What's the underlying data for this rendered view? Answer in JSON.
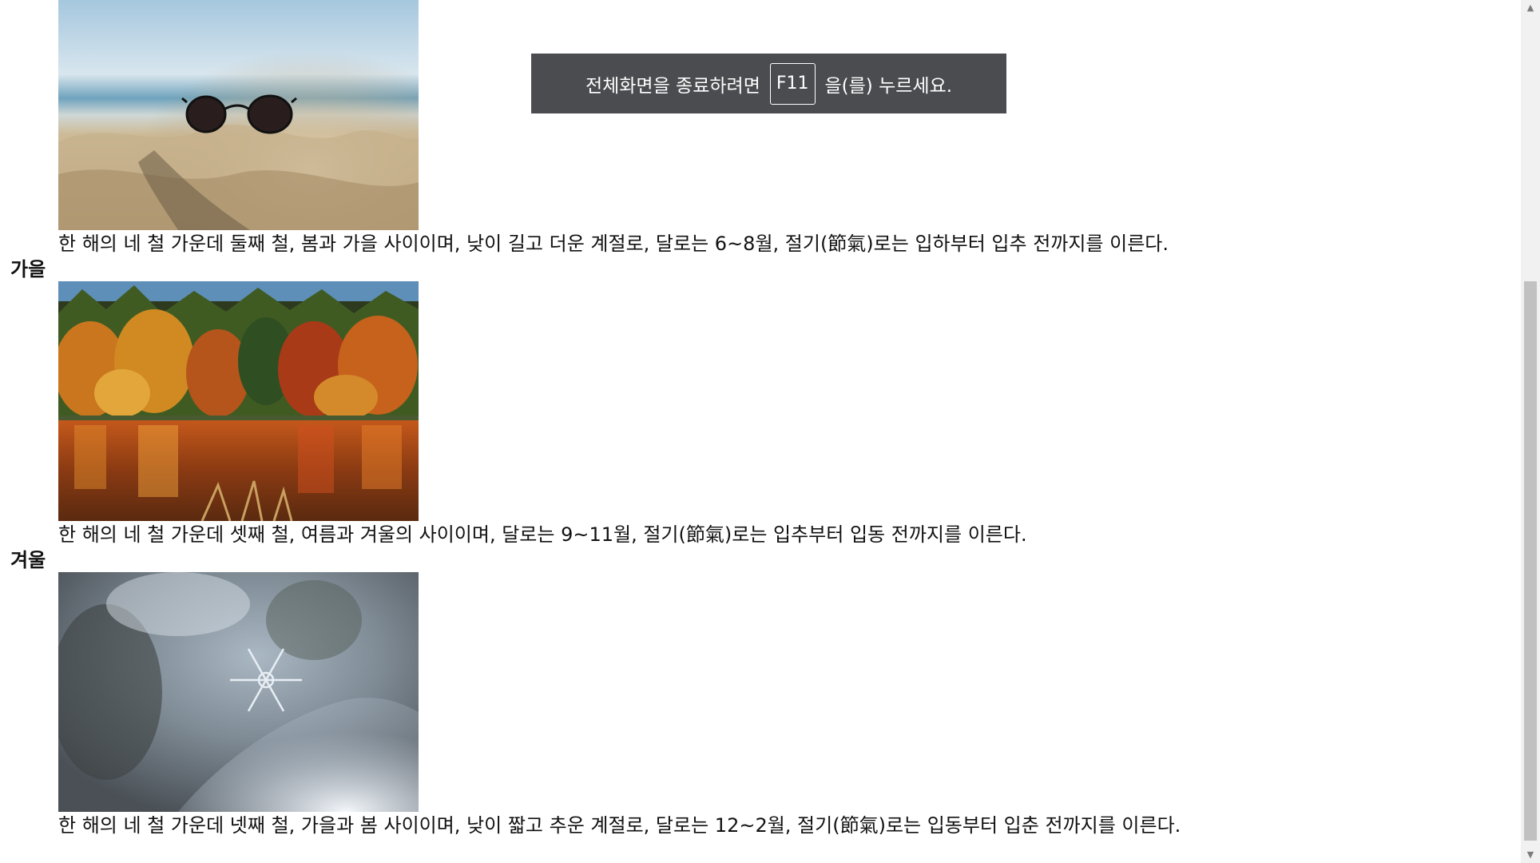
{
  "toast": {
    "before": "전체화면을 종료하려면",
    "key": "F11",
    "after": "을(를) 누르세요."
  },
  "seasons": [
    {
      "title": "",
      "image": "beach-sunglasses-photo",
      "desc": "한 해의 네 철 가운데 둘째 철, 봄과 가을 사이이며, 낮이 길고 더운 계절로, 달로는 6~8월, 절기(節氣)로는 입하부터 입추 전까지를 이른다."
    },
    {
      "title": "가을",
      "image": "autumn-forest-lake-photo",
      "desc": "한 해의 네 철 가운데 셋째 철, 여름과 겨울의 사이이며, 달로는 9~11월, 절기(節氣)로는 입추부터 입동 전까지를 이른다."
    },
    {
      "title": "겨울",
      "image": "snowflake-photo",
      "desc": "한 해의 네 철 가운데 넷째 철, 가을과 봄 사이이며, 낮이 짧고 추운 계절로, 달로는 12~2월, 절기(節氣)로는 입동부터 입춘 전까지를 이른다."
    }
  ],
  "scrollbar": {
    "up_icon": "scroll-up-arrow-icon",
    "down_icon": "scroll-down-arrow-icon"
  }
}
